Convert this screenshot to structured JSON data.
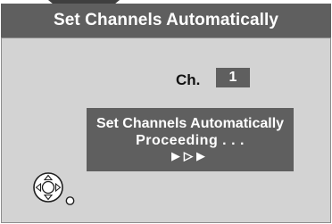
{
  "header": {
    "title": "Set Channels Automatically"
  },
  "channel": {
    "label": "Ch.",
    "value": "1"
  },
  "status": {
    "line1": "Set Channels Automatically",
    "line2": "Proceeding . . .",
    "progress_arrows": [
      "▶",
      "▷",
      "▶"
    ]
  },
  "icons": {
    "navigation": "remote-navigation-joystick-icon",
    "select": "select-button-circle-icon"
  },
  "colors": {
    "title_bar": "#5f5f5f",
    "panel_bg": "#d3d3d3",
    "status_box": "#5f5f5f",
    "text_light": "#ffffff",
    "text_dark": "#111111"
  }
}
